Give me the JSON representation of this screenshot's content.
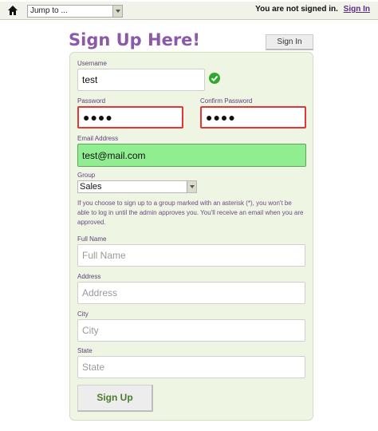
{
  "topbar": {
    "jump_to": "Jump to ...",
    "status": "You are not signed in.",
    "signin_link": "Sign In"
  },
  "header": {
    "title": "Sign Up Here!",
    "signin_button": "Sign In"
  },
  "form": {
    "username": {
      "label": "Username",
      "value": "test"
    },
    "password": {
      "label": "Password",
      "value": "●●●●"
    },
    "confirm_password": {
      "label": "Confirm Password",
      "value": "●●●●"
    },
    "email": {
      "label": "Email Address",
      "value": "test@mail.com"
    },
    "group": {
      "label": "Group",
      "value": "Sales"
    },
    "group_help": "If you choose to sign up to a group marked with an asterisk (*), you won't be able to log in until the admin approves you. You'll receive an email when you are approved.",
    "full_name": {
      "label": "Full Name",
      "placeholder": "Full Name"
    },
    "address": {
      "label": "Address",
      "placeholder": "Address"
    },
    "city": {
      "label": "City",
      "placeholder": "City"
    },
    "state": {
      "label": "State",
      "placeholder": "State"
    },
    "submit": "Sign Up"
  },
  "colors": {
    "title": "#8a5aa8",
    "panel": "#eef5e3",
    "valid": "#90ee90",
    "error": "#e53535",
    "submit_text": "#4d7a2e"
  },
  "icons": {
    "home": "home-icon",
    "check": "check-icon"
  }
}
